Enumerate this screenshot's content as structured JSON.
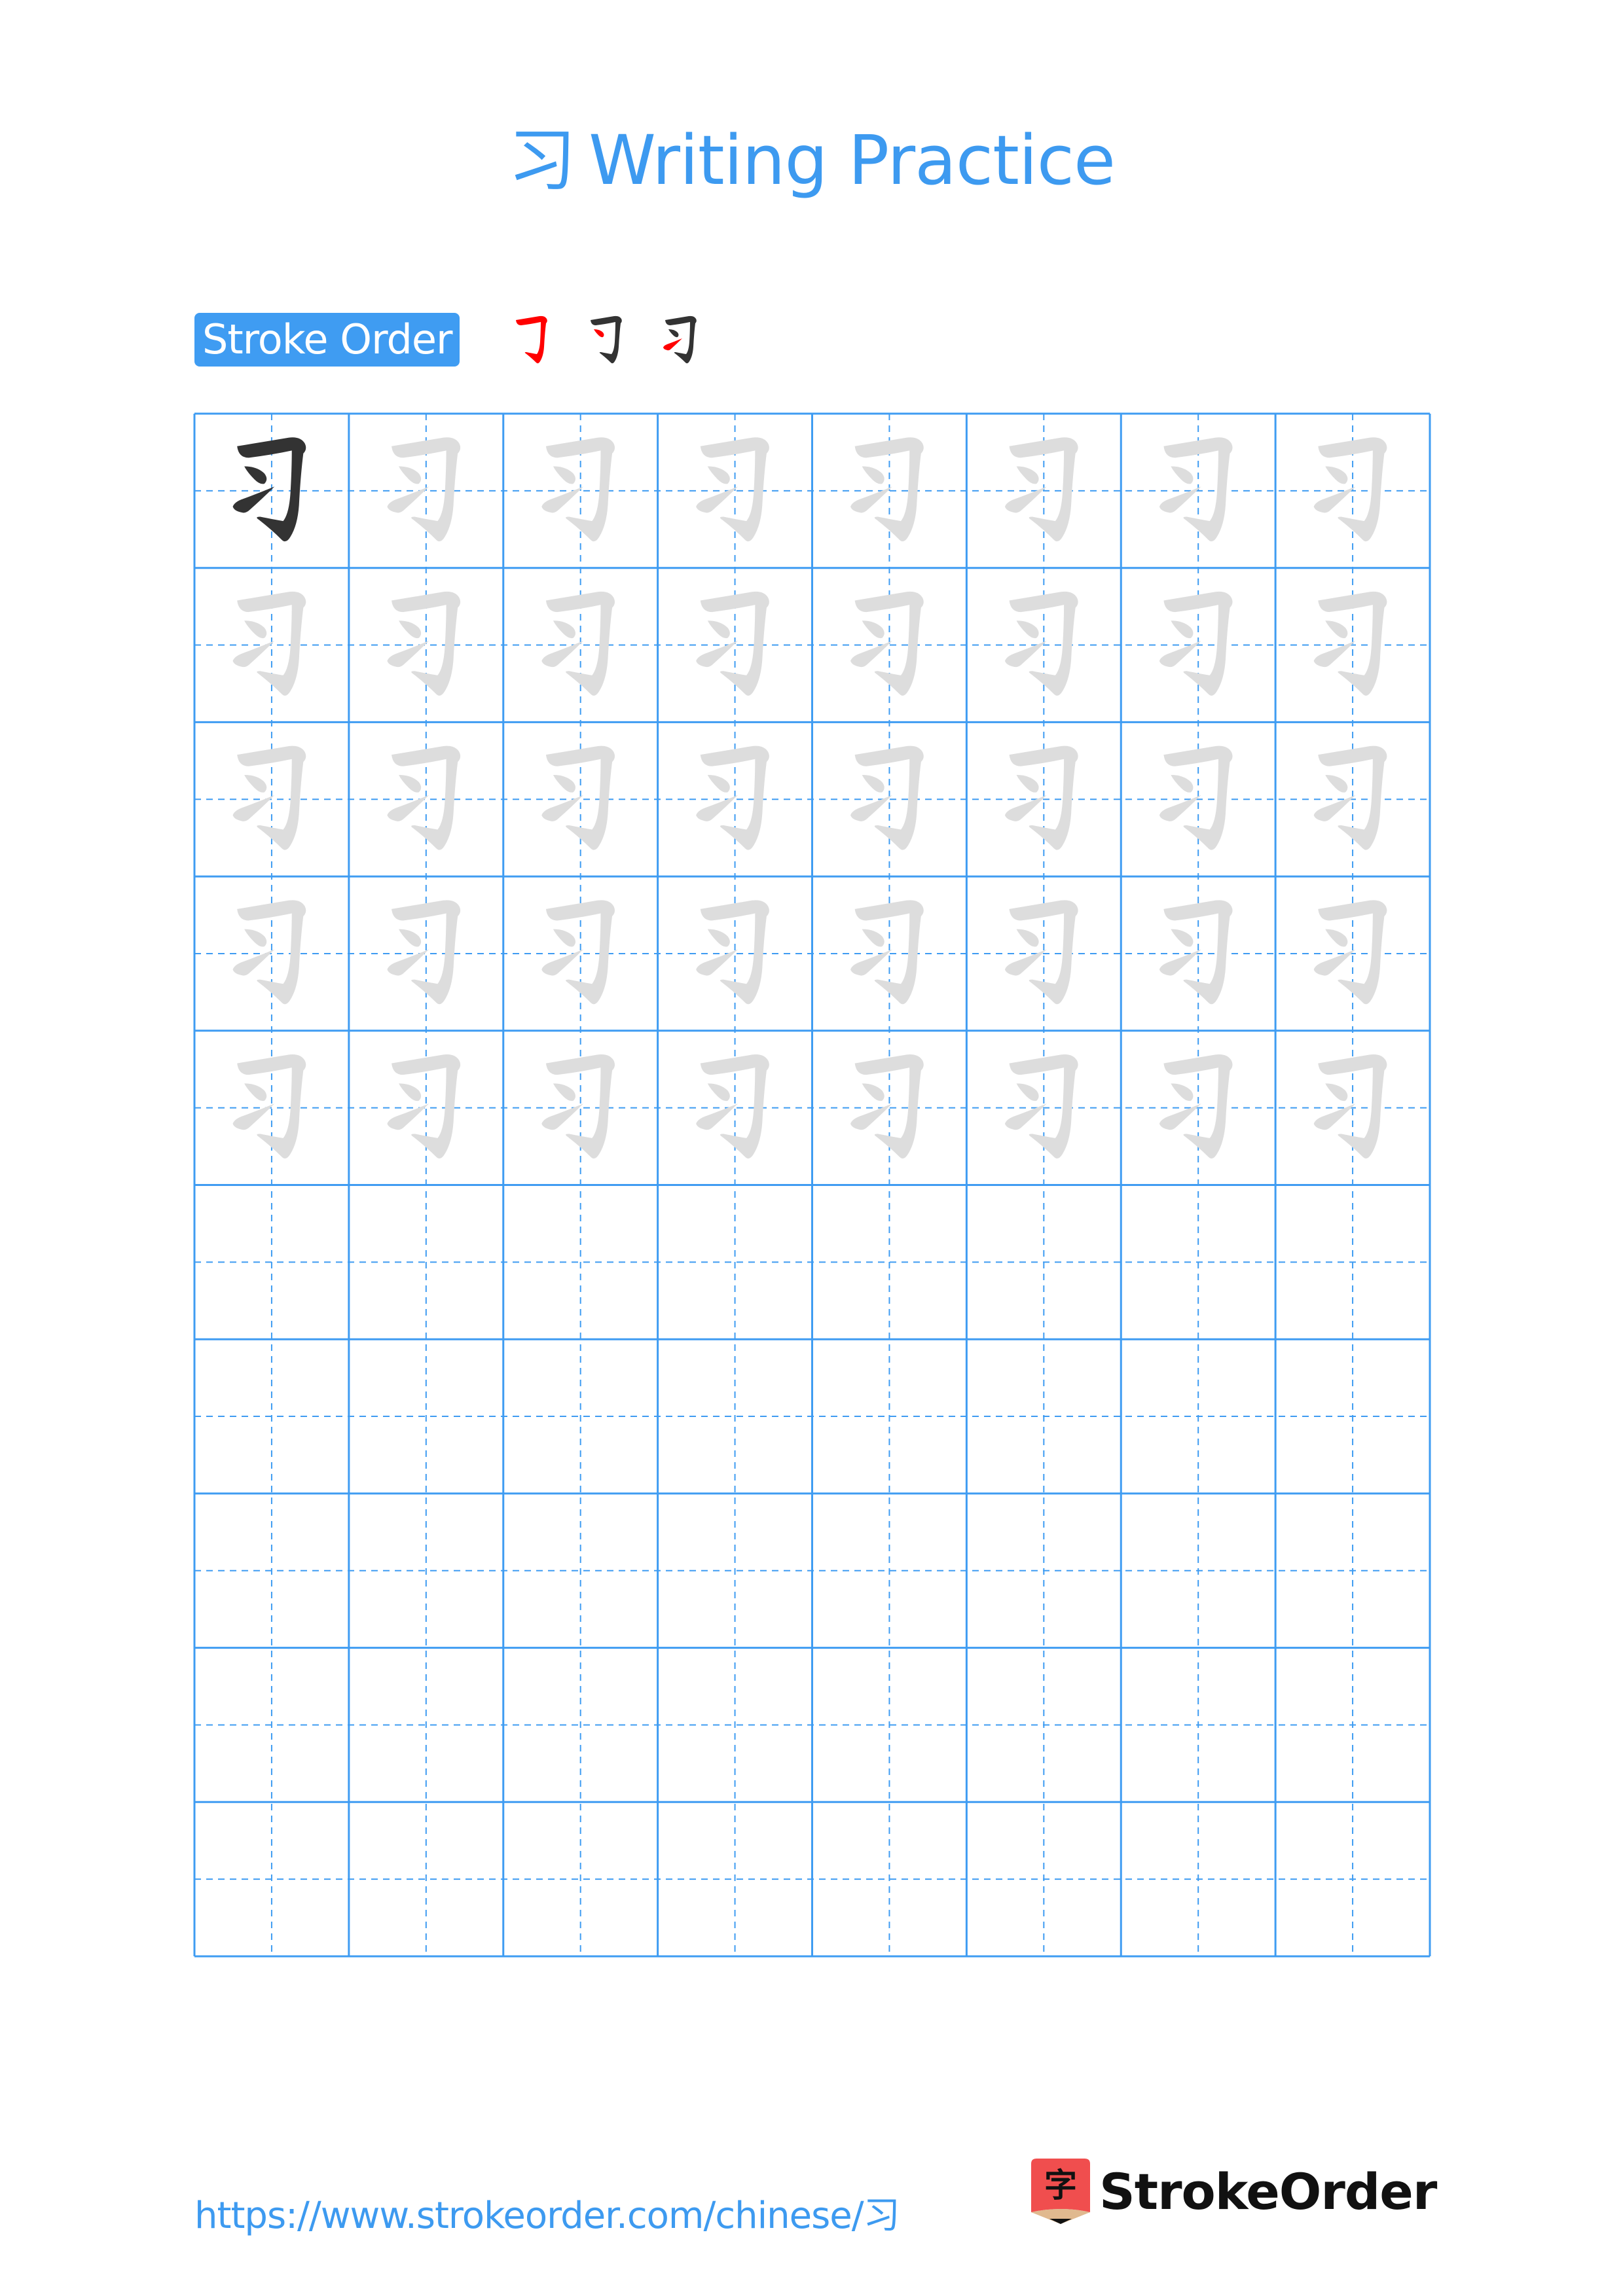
{
  "page": {
    "title_char": "习",
    "title_text": "Writing Practice"
  },
  "stroke_order": {
    "label": "Stroke Order",
    "step_count": 3,
    "steps": [
      {
        "index": 1,
        "highlight_stroke": 1
      },
      {
        "index": 2,
        "highlight_stroke": 2
      },
      {
        "index": 3,
        "highlight_stroke": 3
      }
    ],
    "highlight_color": "#ff0000",
    "done_color": "#333333"
  },
  "grid": {
    "columns": 8,
    "rows": 10,
    "character": "习",
    "model_cells": 1,
    "trace_rows": 5,
    "blank_rows": 5,
    "line_color": "#3f9cf2",
    "model_color": "#333333",
    "trace_color": "#dddddd"
  },
  "footer": {
    "url": "https://www.strokeorder.com/chinese/习",
    "brand_name": "StrokeOrder",
    "brand_logo_char": "字",
    "brand_logo_color": "#f04e4e",
    "brand_logo_tip_color": "#e0b98f"
  }
}
